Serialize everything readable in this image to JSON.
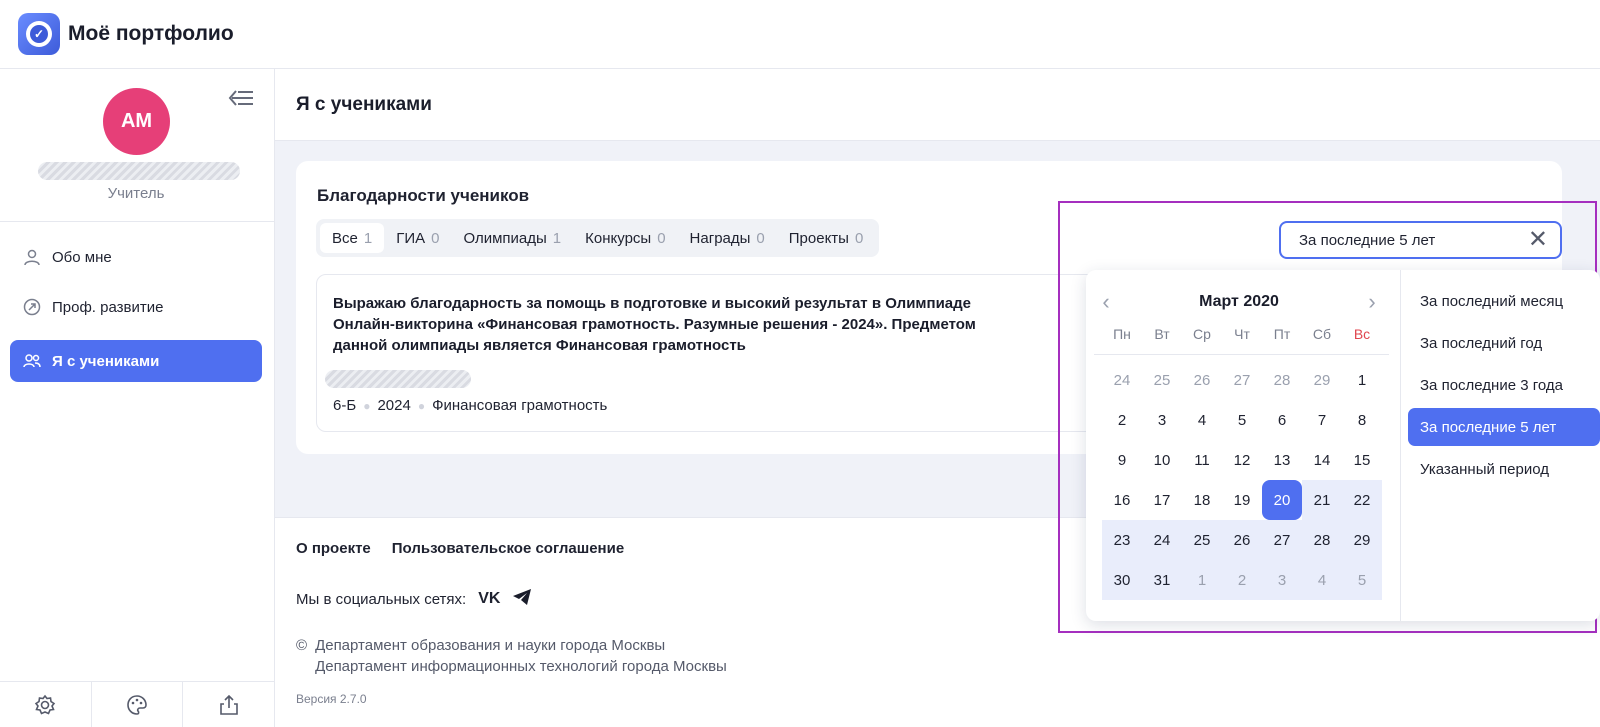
{
  "app": {
    "title": "Моё портфолио"
  },
  "sidebar": {
    "avatar_initials": "АМ",
    "role": "Учитель",
    "items": [
      {
        "label": "Обо мне",
        "icon": "user-icon"
      },
      {
        "label": "Проф. развитие",
        "icon": "growth-icon"
      },
      {
        "label": "Я с учениками",
        "icon": "students-icon",
        "active": true
      }
    ],
    "footer_icons": [
      "settings-icon",
      "palette-icon",
      "share-icon"
    ]
  },
  "page": {
    "title": "Я с учениками"
  },
  "card": {
    "title": "Благодарности учеников",
    "tabs": [
      {
        "label": "Все",
        "count": "1"
      },
      {
        "label": "ГИА",
        "count": "0"
      },
      {
        "label": "Олимпиады",
        "count": "1"
      },
      {
        "label": "Конкурсы",
        "count": "0"
      },
      {
        "label": "Награды",
        "count": "0"
      },
      {
        "label": "Проекты",
        "count": "0"
      }
    ],
    "filter": {
      "value": "За последние 5 лет"
    },
    "item": {
      "text": "Выражаю благодарность за помощь в подготовке и высокий результат в Олимпиаде Онлайн-викторина «Финансовая грамотность. Разумные решения - 2024». Предметом данной олимпиады является Финансовая грамотность",
      "class": "6-Б",
      "year": "2024",
      "subject": "Финансовая грамотность"
    }
  },
  "footer": {
    "about": "О проекте",
    "agreement": "Пользовательское соглашение",
    "social_label": "Мы в социальных сетях:",
    "social_vk": "VK",
    "copyright_symbol": "©",
    "dept1": "Департамент образования и науки города Москвы",
    "dept2": "Департамент информационных технологий города Москвы",
    "version": "Версия 2.7.0"
  },
  "calendar": {
    "month": "Март 2020",
    "weekdays": [
      "Пн",
      "Вт",
      "Ср",
      "Чт",
      "Пт",
      "Сб",
      "Вс"
    ],
    "weeks": [
      [
        "24",
        "25",
        "26",
        "27",
        "28",
        "29",
        "1"
      ],
      [
        "2",
        "3",
        "4",
        "5",
        "6",
        "7",
        "8"
      ],
      [
        "9",
        "10",
        "11",
        "12",
        "13",
        "14",
        "15"
      ],
      [
        "16",
        "17",
        "18",
        "19",
        "20",
        "21",
        "22"
      ],
      [
        "23",
        "24",
        "25",
        "26",
        "27",
        "28",
        "29"
      ],
      [
        "30",
        "31",
        "1",
        "2",
        "3",
        "4",
        "5"
      ]
    ],
    "selected": "20"
  },
  "presets": [
    "За последний месяц",
    "За последний год",
    "За последние 3 года",
    "За последние 5 лет",
    "Указанный период"
  ],
  "colors": {
    "accent": "#4f6ff0",
    "avatar": "#e63f78",
    "highlight": "#a52fbf",
    "sunday": "#e0464f"
  }
}
